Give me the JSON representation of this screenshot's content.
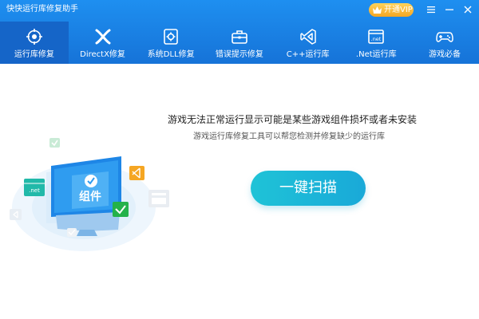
{
  "app": {
    "title": "快快运行库修复助手",
    "vip_label": "开通VIP"
  },
  "nav": {
    "items": [
      {
        "label": "运行库修复",
        "icon": "target-icon",
        "active": true
      },
      {
        "label": "DirectX修复",
        "icon": "directx-icon",
        "active": false
      },
      {
        "label": "系统DLL修复",
        "icon": "dll-gear-icon",
        "active": false
      },
      {
        "label": "错误提示修复",
        "icon": "toolbox-icon",
        "active": false
      },
      {
        "label": "C++运行库",
        "icon": "visual-studio-icon",
        "active": false
      },
      {
        "label": ".Net运行库",
        "icon": "dotnet-icon",
        "active": false
      },
      {
        "label": "游戏必备",
        "icon": "gamepad-icon",
        "active": false
      }
    ]
  },
  "main": {
    "message_title": "游戏无法正常运行显示可能是某些游戏组件损坏或者未安装",
    "message_sub": "游戏运行库修复工具可以帮您检测并修复缺少的运行库",
    "scan_button": "一键扫描",
    "illustration": {
      "monitor_label": "组件",
      "badge_net": ".net"
    }
  },
  "colors": {
    "header_blue": "#1e8ff0",
    "active_tab": "#1565c8",
    "scan_teal": "#1fc3d7",
    "vip_gold": "#f5a623"
  }
}
